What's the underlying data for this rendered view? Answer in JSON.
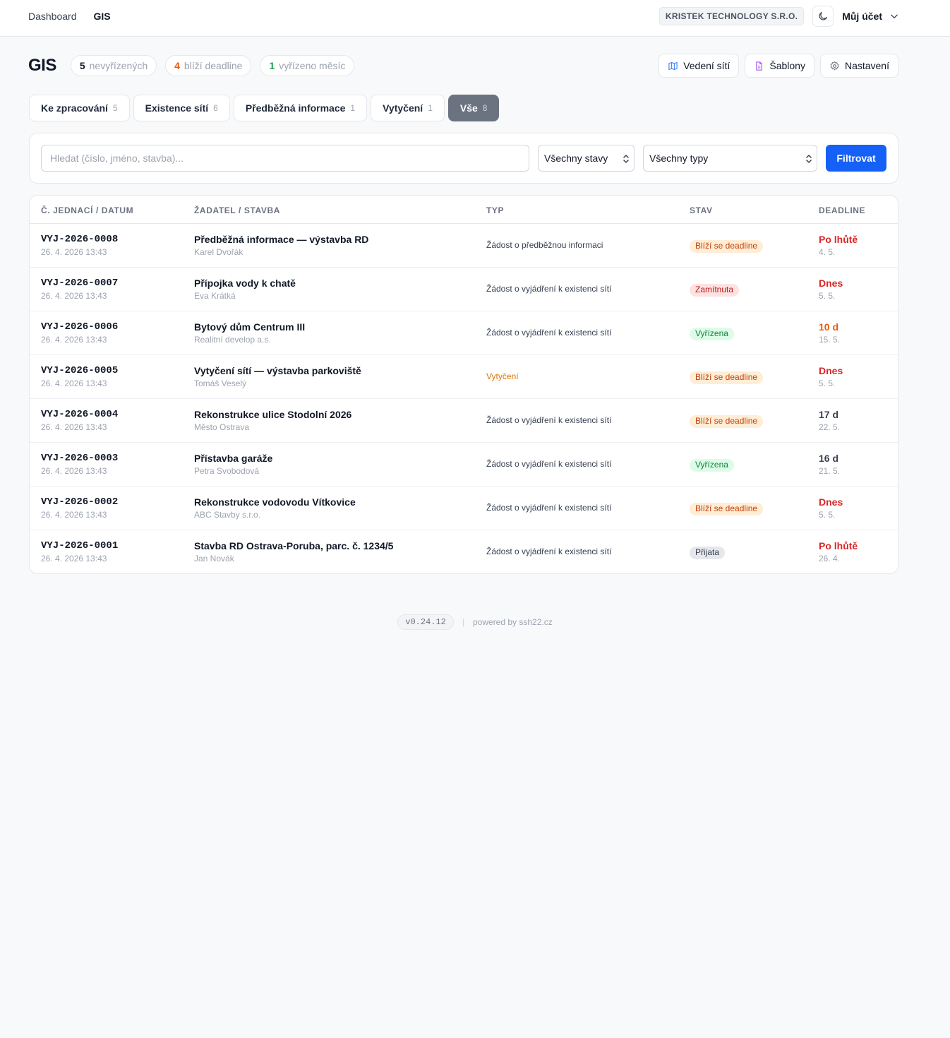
{
  "nav": {
    "items": [
      {
        "label": "Dashboard"
      },
      {
        "label": "GIS"
      }
    ]
  },
  "company": "KRISTEK TECHNOLOGY S.R.O.",
  "account": "Můj účet",
  "page": {
    "title": "GIS",
    "stats": [
      {
        "count": "5",
        "label": "nevyřízených",
        "color": "#111827"
      },
      {
        "count": "4",
        "label": "blíží deadline",
        "color": "#ea580c"
      },
      {
        "count": "1",
        "label": "vyřízeno měsíc",
        "color": "#16a34a"
      }
    ],
    "buttons": {
      "networks": "Vedení sítí",
      "templates": "Šablony",
      "settings": "Nastavení"
    }
  },
  "tabs": [
    {
      "label": "Ke zpracování",
      "count": "5"
    },
    {
      "label": "Existence sítí",
      "count": "6"
    },
    {
      "label": "Předběžná informace",
      "count": "1"
    },
    {
      "label": "Vytyčení",
      "count": "1"
    },
    {
      "label": "Vše",
      "count": "8",
      "active": true
    }
  ],
  "filter": {
    "search_placeholder": "Hledat (číslo, jméno, stavba)...",
    "state_select": "Všechny stavy",
    "type_select": "Všechny typy",
    "submit": "Filtrovat"
  },
  "table": {
    "headers": {
      "id": "Č. JEDNACÍ / DATUM",
      "applicant": "ŽADATEL / STAVBA",
      "type": "TYP",
      "state": "STAV",
      "deadline": "DEADLINE"
    },
    "rows": [
      {
        "id": "VYJ-2026-0008",
        "date": "26. 4. 2026 13:43",
        "name": "Předběžná informace — výstavba RD",
        "applicant": "Karel Dvořák",
        "type": "Žádost o předběžnou informaci",
        "type_color": "#374151",
        "state": "Blíží se deadline",
        "state_bg": "#ffedd5",
        "state_fg": "#c2410c",
        "deadline": "Po lhůtě",
        "deadline_color": "#dc2626",
        "deadline_date": "4. 5."
      },
      {
        "id": "VYJ-2026-0007",
        "date": "26. 4. 2026 13:43",
        "name": "Přípojka vody k chatě",
        "applicant": "Eva Krátká",
        "type": "Žádost o vyjádření k existenci sítí",
        "type_color": "#374151",
        "state": "Zamítnuta",
        "state_bg": "#fee2e2",
        "state_fg": "#b91c1c",
        "deadline": "Dnes",
        "deadline_color": "#dc2626",
        "deadline_date": "5. 5."
      },
      {
        "id": "VYJ-2026-0006",
        "date": "26. 4. 2026 13:43",
        "name": "Bytový dům Centrum III",
        "applicant": "Realitní develop a.s.",
        "type": "Žádost o vyjádření k existenci sítí",
        "type_color": "#374151",
        "state": "Vyřízena",
        "state_bg": "#dcfce7",
        "state_fg": "#15803d",
        "deadline": "10 d",
        "deadline_color": "#ea580c",
        "deadline_date": "15. 5."
      },
      {
        "id": "VYJ-2026-0005",
        "date": "26. 4. 2026 13:43",
        "name": "Vytyčení sítí — výstavba parkoviště",
        "applicant": "Tomáš Veselý",
        "type": "Vytyčení",
        "type_color": "#d97706",
        "state": "Blíží se deadline",
        "state_bg": "#ffedd5",
        "state_fg": "#c2410c",
        "deadline": "Dnes",
        "deadline_color": "#dc2626",
        "deadline_date": "5. 5."
      },
      {
        "id": "VYJ-2026-0004",
        "date": "26. 4. 2026 13:43",
        "name": "Rekonstrukce ulice Stodolní 2026",
        "applicant": "Město Ostrava",
        "type": "Žádost o vyjádření k existenci sítí",
        "type_color": "#374151",
        "state": "Blíží se deadline",
        "state_bg": "#ffedd5",
        "state_fg": "#c2410c",
        "deadline": "17 d",
        "deadline_color": "#374151",
        "deadline_date": "22. 5."
      },
      {
        "id": "VYJ-2026-0003",
        "date": "26. 4. 2026 13:43",
        "name": "Přístavba garáže",
        "applicant": "Petra Svobodová",
        "type": "Žádost o vyjádření k existenci sítí",
        "type_color": "#374151",
        "state": "Vyřízena",
        "state_bg": "#dcfce7",
        "state_fg": "#15803d",
        "deadline": "16 d",
        "deadline_color": "#374151",
        "deadline_date": "21. 5."
      },
      {
        "id": "VYJ-2026-0002",
        "date": "26. 4. 2026 13:43",
        "name": "Rekonstrukce vodovodu Vítkovice",
        "applicant": "ABC Stavby s.r.o.",
        "type": "Žádost o vyjádření k existenci sítí",
        "type_color": "#374151",
        "state": "Blíží se deadline",
        "state_bg": "#ffedd5",
        "state_fg": "#c2410c",
        "deadline": "Dnes",
        "deadline_color": "#dc2626",
        "deadline_date": "5. 5."
      },
      {
        "id": "VYJ-2026-0001",
        "date": "26. 4. 2026 13:43",
        "name": "Stavba RD Ostrava-Poruba, parc. č. 1234/5",
        "applicant": "Jan Novák",
        "type": "Žádost o vyjádření k existenci sítí",
        "type_color": "#374151",
        "state": "Přijata",
        "state_bg": "#e5e7eb",
        "state_fg": "#374151",
        "deadline": "Po lhůtě",
        "deadline_color": "#dc2626",
        "deadline_date": "26. 4."
      }
    ]
  },
  "footer": {
    "version": "v0.24.12",
    "powered": "powered by ssh22.cz"
  },
  "icons": {
    "theme": "moon-icon",
    "account": "chevron-down-icon",
    "networks": "map-icon",
    "templates": "document-icon",
    "settings": "gear-icon",
    "select": "updown-caret-icon"
  },
  "colors": {
    "primary": "#1560f7",
    "active_tab": "#6b7280"
  }
}
